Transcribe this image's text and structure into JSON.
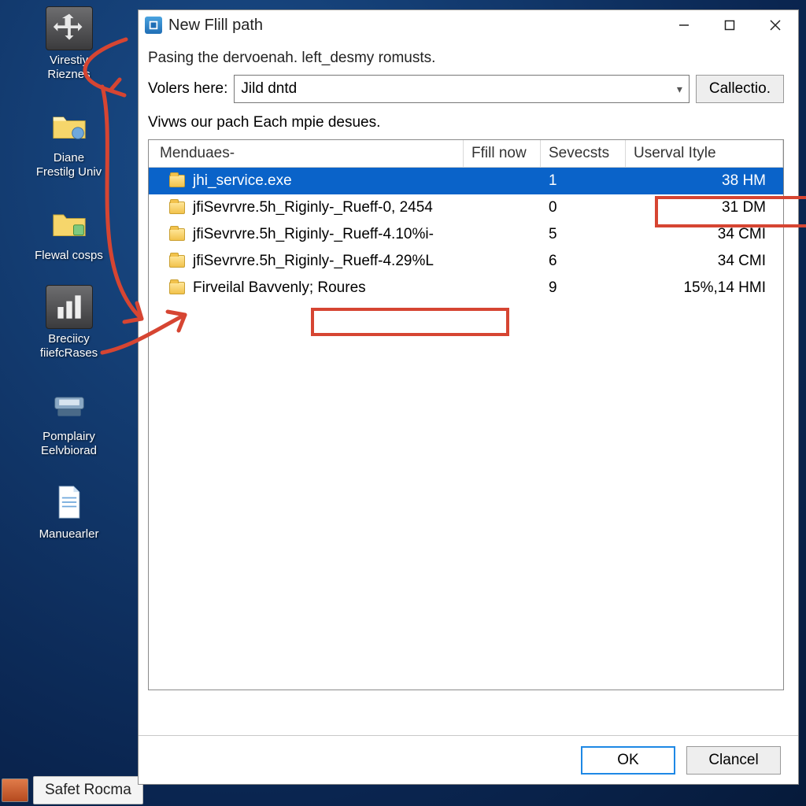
{
  "desktop_icons": [
    {
      "label1": "Virestiy",
      "label2": "Rieznes"
    },
    {
      "label1": "Diane",
      "label2": "Frestilg Univ"
    },
    {
      "label1": "Flewal cosps",
      "label2": ""
    },
    {
      "label1": "Breciicy",
      "label2": "fiiefcRases"
    },
    {
      "label1": "Pomplairy",
      "label2": "Eelvbiorad"
    },
    {
      "label1": "Manuearler",
      "label2": ""
    }
  ],
  "dialog": {
    "title": "New Flill path",
    "desc_top": "Pasing the dervoenah. left_desmy romusts.",
    "volers_label": "Volers here:",
    "volers_value": "Jild dntd",
    "collect_btn": "Callectio.",
    "desc_list": "Vivws our pach Each mpie desues.",
    "columns": {
      "c1": "Menduaes-",
      "c2": "Ffill now",
      "c3": "Sevecsts",
      "c4": "Userval Ityle"
    },
    "rows": [
      {
        "name": "jhi_service.exe",
        "fill": "",
        "sev": "1",
        "use": "38 HM",
        "selected": true
      },
      {
        "name": "jfiSevrvre.5h_Riginly-_Rueff-0, 2454",
        "fill": "",
        "sev": "0",
        "use": "31 DM"
      },
      {
        "name": "jfiSevrvre.5h_Riginly-_Rueff-4.10%i-",
        "fill": "",
        "sev": "5",
        "use": "34 CMI"
      },
      {
        "name": "jfiSevrvre.5h_Riginly-_Rueff-4.29%L",
        "fill": "",
        "sev": "6",
        "use": "34 CMI"
      },
      {
        "name": "Firveilal Bavvenly; Roures",
        "fill": "",
        "sev": "9",
        "use": "15%,14 HMI"
      }
    ],
    "ok": "OK",
    "cancel": "Clancel"
  },
  "taskbar": {
    "label": "Safet Rocma"
  }
}
